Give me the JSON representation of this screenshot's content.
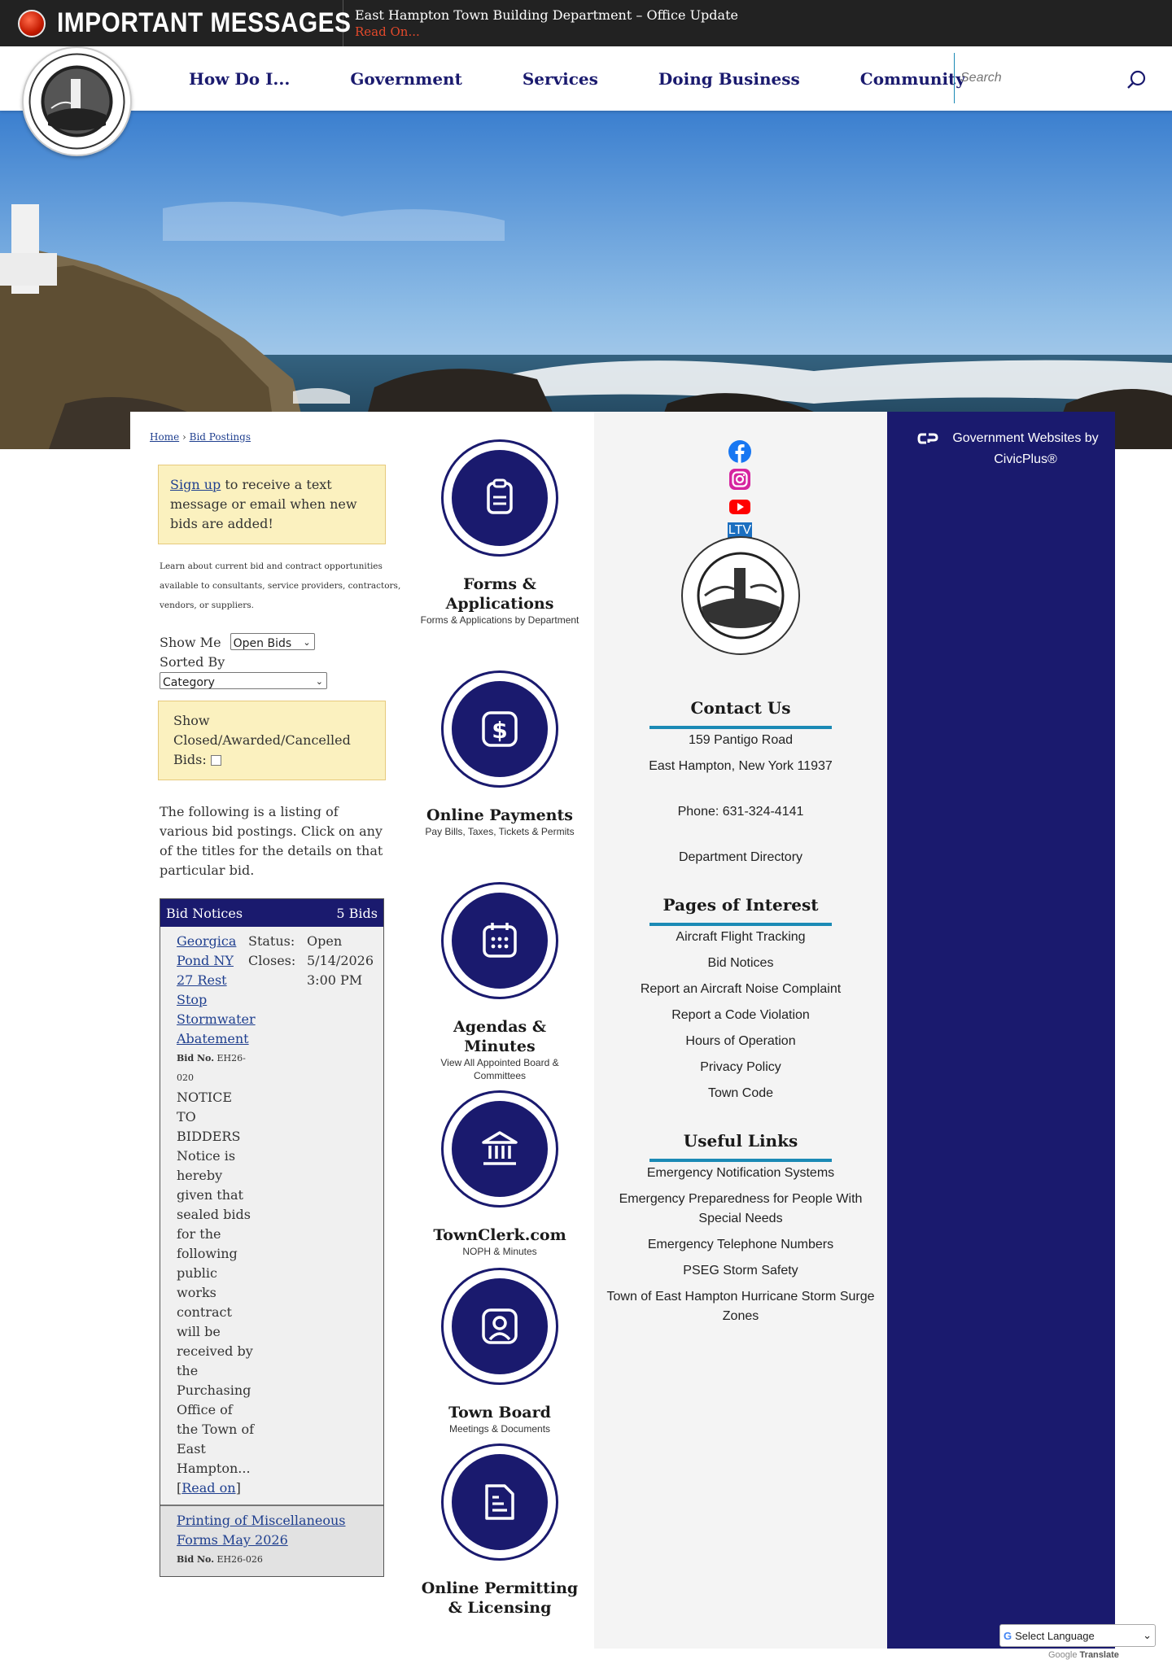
{
  "alert": {
    "label": "IMPORTANT MESSAGES",
    "title": "East Hampton Town Building Department – Office Update",
    "read": "Read On..."
  },
  "nav": {
    "items": [
      "How Do I...",
      "Government",
      "Services",
      "Doing Business",
      "Community"
    ]
  },
  "search": {
    "placeholder": "Search"
  },
  "breadcrumb": {
    "home": "Home",
    "sep": "›",
    "current": "Bid Postings"
  },
  "notice": {
    "link": "Sign up",
    "text": " to receive a text message or email when new bids are added!"
  },
  "intro": "Learn about current bid and contract opportunities available to consultants, service providers, contractors, vendors, or suppliers.",
  "filters": {
    "show_me_label": "Show Me",
    "show_me_value": "Open Bids",
    "sorted_by_label": "Sorted By",
    "sorted_by_value": "Category",
    "closed_label": "Show Closed/Awarded/Cancelled Bids:"
  },
  "listing": "The following is a listing of various bid postings. Click on any of the titles for the details on that particular bid.",
  "bids": {
    "header": "Bid Notices",
    "count": "5 Bids",
    "items": [
      {
        "title": "Georgica Pond NY 27 Rest Stop Stormwater Abatement",
        "status_label": "Status:",
        "status": "Open",
        "closes_label": "Closes:",
        "closes": "5/14/2026",
        "time": "3:00 PM",
        "bidno_label": "Bid No.",
        "bidno": "EH26-020",
        "body": "NOTICE TO BIDDERS Notice is hereby given that sealed bids for the following public works contract will be received by the Purchasing Office of the Town of East Hampton...",
        "read_on": "Read on"
      },
      {
        "title": "Printing of Miscellaneous Forms May 2026",
        "bidno_label": "Bid No.",
        "bidno": "EH26-026"
      }
    ]
  },
  "quick_links": [
    {
      "title": "Forms & Applications",
      "sub": "Forms & Applications by Department",
      "icon": "clipboard-icon"
    },
    {
      "title": "Online Payments",
      "sub": "Pay Bills, Taxes, Tickets & Permits",
      "icon": "dollar-icon"
    },
    {
      "title": "Agendas & Minutes",
      "sub": "View All Appointed Board & Committees",
      "icon": "calendar-icon"
    },
    {
      "title": "TownClerk.com",
      "sub": "NOPH & Minutes",
      "icon": "building-icon"
    },
    {
      "title": "Town Board",
      "sub": "Meetings & Documents",
      "icon": "person-icon"
    },
    {
      "title": "Online Permitting & Licensing",
      "sub": "",
      "icon": "document-icon"
    }
  ],
  "contact": {
    "title": "Contact Us",
    "address1": "159 Pantigo Road",
    "address2": "East Hampton, New York 11937",
    "phone": "Phone: 631-324-4141",
    "directory": "Department Directory"
  },
  "pages_of_interest": {
    "title": "Pages of Interest",
    "items": [
      "Aircraft Flight Tracking",
      "Bid Notices",
      "Report an Aircraft Noise Complaint",
      "Report a Code Violation",
      "Hours of Operation",
      "Privacy Policy",
      "Town Code"
    ]
  },
  "useful_links": {
    "title": "Useful Links",
    "items": [
      "Emergency Notification Systems",
      "Emergency Preparedness for People With Special Needs",
      "Emergency Telephone Numbers",
      "PSEG Storm Safety",
      "Town of East Hampton Hurricane Storm Surge Zones"
    ]
  },
  "civicplus": "Government Websites by CivicPlus®",
  "translate": {
    "select": "Select Language",
    "powered": "Google",
    "translate": "Translate"
  },
  "social": {
    "ltv": "LTV"
  },
  "colors": {
    "navy": "#1a1a6e",
    "teal": "#1b8ab5",
    "alert_red": "#e2492b",
    "notice_yellow": "#fbf1bf"
  }
}
